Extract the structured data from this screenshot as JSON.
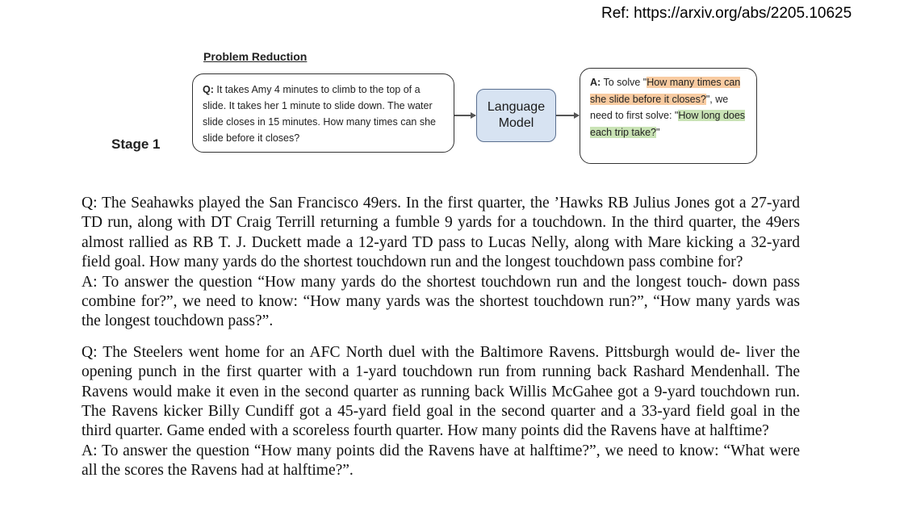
{
  "reference": "Ref: https://arxiv.org/abs/2205.10625",
  "diagram": {
    "title": "Problem Reduction",
    "stage": "Stage 1",
    "question_box": {
      "prefix": "Q:",
      "text": "It takes Amy 4 minutes to climb to the top of a slide. It takes her 1 minute to slide down. The water slide closes in 15 minutes. How many times can she slide before it closes?"
    },
    "model_box": {
      "line1": "Language",
      "line2": "Model"
    },
    "answer_box": {
      "prefix": "A:",
      "text_before": " To solve \"",
      "highlight_orange": "How many times can she slide before it closes?",
      "text_middle": "\", we need to first solve: \"",
      "highlight_green": "How long does each trip take?",
      "text_end": "\"",
      "colors": {
        "orange_highlight": "#f8cba1",
        "green_highlight": "#c9e3b5",
        "model_fill": "#d7e3f2"
      }
    }
  },
  "examples": [
    {
      "question": "Q: The Seahawks played the San Francisco 49ers. In the first quarter, the ’Hawks RB Julius Jones got a 27-yard TD run, along with DT Craig Terrill returning a fumble 9 yards for a touchdown. In the third quarter, the 49ers almost rallied as RB T. J. Duckett made a 12-yard TD pass to Lucas Nelly, along with Mare kicking a 32-yard field goal. How many yards do the shortest touchdown run and the longest touchdown pass combine for?",
      "answer": "A: To answer the question “How many yards do the shortest touchdown run and the longest touch- down pass combine for?”, we need to know: “How many yards was the shortest touchdown run?”, “How many yards was the longest touchdown pass?”."
    },
    {
      "question": "Q: The Steelers went home for an AFC North duel with the Baltimore Ravens. Pittsburgh would de- liver the opening punch in the first quarter with a 1-yard touchdown run from running back Rashard Mendenhall. The Ravens would make it even in the second quarter as running back Willis McGahee got a 9-yard touchdown run. The Ravens kicker Billy Cundiff got a 45-yard field goal in the second quarter and a 33-yard field goal in the third quarter. Game ended with a scoreless fourth quarter. How many points did the Ravens have at halftime?",
      "answer": "A: To answer the question “How many points did the Ravens have at halftime?”, we need to know: “What were all the scores the Ravens had at halftime?”."
    }
  ]
}
